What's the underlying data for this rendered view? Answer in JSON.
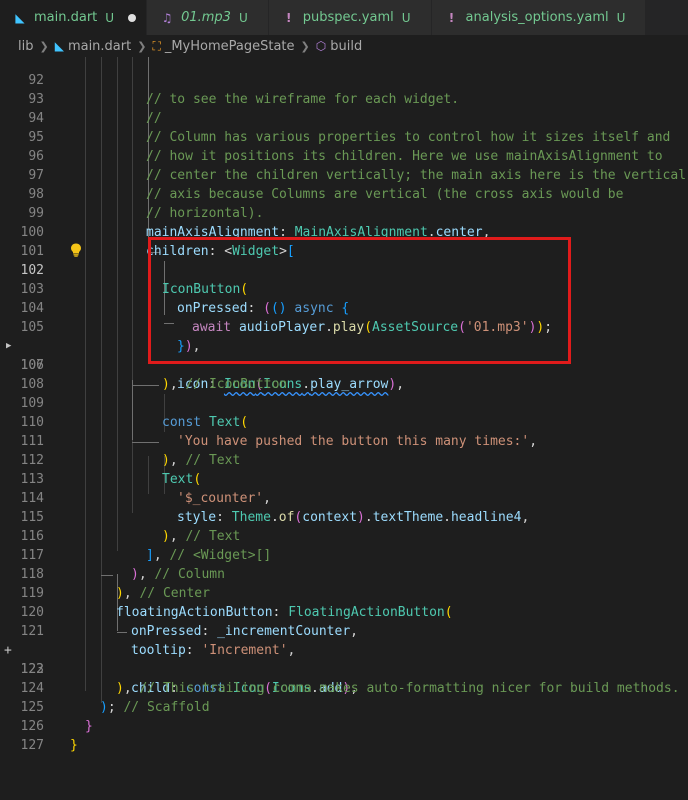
{
  "tabs": [
    {
      "icon": "dart-file-icon",
      "label": "main.dart",
      "status": "U",
      "active": true,
      "dirty": true
    },
    {
      "icon": "audio-file-icon",
      "label": "01.mp3",
      "status": "U",
      "active": false
    },
    {
      "icon": "yaml-file-icon",
      "label": "pubspec.yaml",
      "status": "U",
      "active": false
    },
    {
      "icon": "yaml-file-icon",
      "label": "analysis_options.yaml",
      "status": "U",
      "active": false
    }
  ],
  "breadcrumb": {
    "folder": "lib",
    "file": "main.dart",
    "class": "_MyHomePageState",
    "method": "build"
  },
  "line_numbers": [
    "92",
    "93",
    "94",
    "95",
    "96",
    "97",
    "98",
    "99",
    "100",
    "101",
    "102",
    "103",
    "104",
    "105",
    "106",
    "107",
    "108",
    "109",
    "110",
    "111",
    "112",
    "113",
    "114",
    "115",
    "116",
    "117",
    "118",
    "119",
    "120",
    "121",
    "122",
    "123",
    "124",
    "125",
    "126",
    "127"
  ],
  "code": {
    "l92": "// to see the wireframe for each widget.",
    "l93": "//",
    "l94": "// Column has various properties to control how it sizes itself and",
    "l95": "// how it positions its children. Here we use mainAxisAlignment to",
    "l96": "// center the children vertically; the main axis here is the vertical",
    "l97": "// axis because Columns are vertical (the cross axis would be",
    "l98": "// horizontal).",
    "l99_prop": "mainAxisAlignment",
    "l99_cls": "MainAxisAlignment",
    "l99_val": "center",
    "l100_prop": "children",
    "l100_type": "Widget",
    "l102_cls": "IconButton",
    "l103_prop": "onPressed",
    "l103_kw": "async",
    "l104_kw": "await",
    "l104_obj": "audioPlayer",
    "l104_fn": "play",
    "l104_cls": "AssetSource",
    "l104_str": "'01.mp3'",
    "l106_prop": "icon",
    "l106_cls": "Icon",
    "l106_icons": "Icons",
    "l106_val": "play_arrow",
    "l107_com": "// IconButton",
    "l109_kw": "const",
    "l109_cls": "Text",
    "l110_str": "'You have pushed the button this many times:'",
    "l111_com": "// Text",
    "l112_cls": "Text",
    "l113_str": "'$_counter'",
    "l114_prop": "style",
    "l114_theme": "Theme",
    "l114_of": "of",
    "l114_ctx": "context",
    "l114_tt": "textTheme",
    "l114_h4": "headline4",
    "l115_com": "// Text",
    "l116_com": "// <Widget>[]",
    "l117_com": "// Column",
    "l118_com": "// Center",
    "l119_prop": "floatingActionButton",
    "l119_cls": "FloatingActionButton",
    "l120_prop": "onPressed",
    "l120_val": "_incrementCounter",
    "l121_prop": "tooltip",
    "l121_str": "'Increment'",
    "l122_prop": "child",
    "l122_kw": "const",
    "l122_cls": "Icon",
    "l122_icons": "Icons",
    "l122_val": "add",
    "l123_com": "// This trailing comma makes auto-formatting nicer for build methods. /",
    "l124_com": "// Scaffold"
  },
  "colors": {
    "highlight_box": "#e01b1b",
    "accent_untracked": "#73c991"
  }
}
